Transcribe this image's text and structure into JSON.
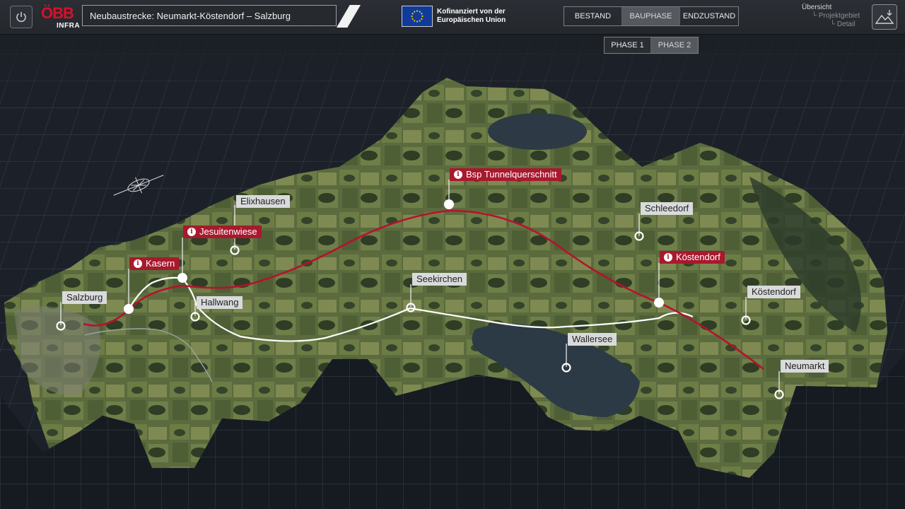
{
  "header": {
    "title": "Neubaustrecke: Neumarkt-Köstendorf – Salzburg",
    "logo_mark": "ÖBB",
    "logo_sub": "INFRA",
    "eu_text_line1": "Kofinanziert von der",
    "eu_text_line2": "Europäischen Union"
  },
  "mode_tabs": [
    {
      "label": "BESTAND",
      "active": false
    },
    {
      "label": "BAUPHASE",
      "active": true
    },
    {
      "label": "ENDZUSTAND",
      "active": false
    }
  ],
  "phase_tabs": [
    {
      "label": "PHASE 1",
      "active": false
    },
    {
      "label": "PHASE 2",
      "active": true
    }
  ],
  "nav_tree": {
    "level1": "Übersicht",
    "level2": "Projektgebiet",
    "level3": "Detail"
  },
  "places": {
    "salzburg": "Salzburg",
    "elixhausen": "Elixhausen",
    "hallwang": "Hallwang",
    "seekirchen": "Seekirchen",
    "schleedorf": "Schleedorf",
    "koestendorf": "Köstendorf",
    "wallersee": "Wallersee",
    "neumarkt": "Neumarkt"
  },
  "poi": {
    "kasern": "Kasern",
    "jesuitenwiese": "Jesuitenwiese",
    "tunnel": "Bsp Tunnelquerschnitt",
    "koestendorf": "Köstendorf"
  },
  "colors": {
    "accent_red": "#a8192e",
    "new_line": "#b8112a",
    "existing_line": "#ffffff"
  }
}
